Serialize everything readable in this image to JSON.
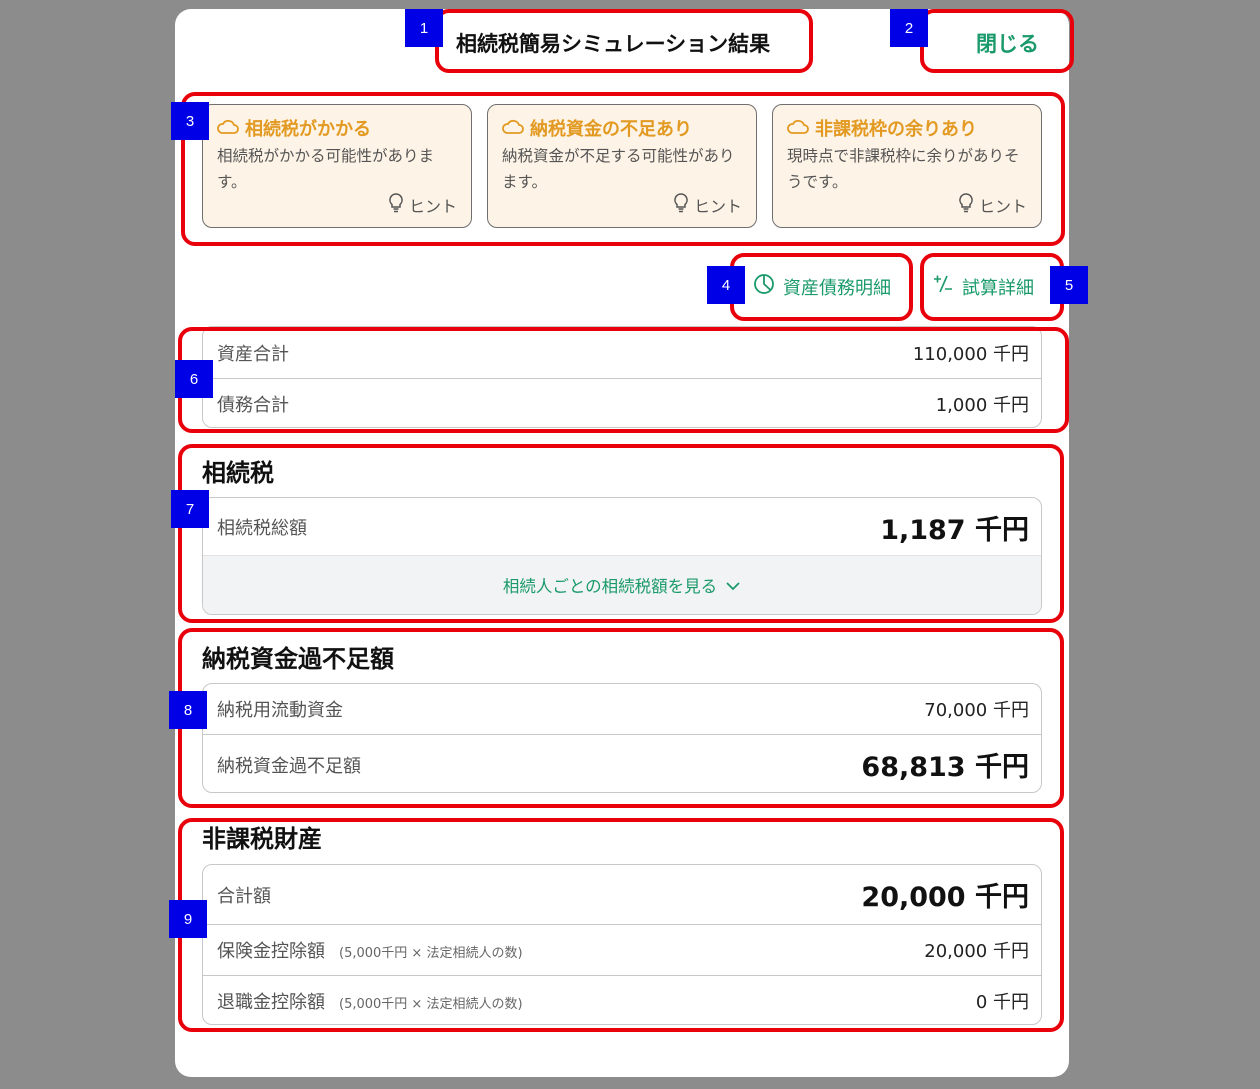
{
  "header": {
    "title": "相続税簡易シミュレーション結果",
    "close_label": "閉じる"
  },
  "markers": [
    "1",
    "2",
    "3",
    "4",
    "5",
    "6",
    "7",
    "8",
    "9"
  ],
  "alerts": [
    {
      "title": "相続税がかかる",
      "body": "相続税がかかる可能性があります。",
      "hint": "ヒント",
      "icon": "cloud-icon"
    },
    {
      "title": "納税資金の不足あり",
      "body": "納税資金が不足する可能性があります。",
      "hint": "ヒント",
      "icon": "cloud-icon"
    },
    {
      "title": "非課税枠の余りあり",
      "body": "現時点で非課税枠に余りがありそうです。",
      "hint": "ヒント",
      "icon": "cloud-icon"
    }
  ],
  "links": {
    "asset_detail": "資産債務明細",
    "calc_detail": "試算詳細"
  },
  "summary": [
    {
      "label": "資産合計",
      "value": "110,000 千円"
    },
    {
      "label": "債務合計",
      "value": "1,000 千円"
    }
  ],
  "inheritance_tax": {
    "title": "相続税",
    "total_label": "相続税総額",
    "total_value": "1,187 千円",
    "expand_label": "相続人ごとの相続税額を見る"
  },
  "funds": {
    "title": "納税資金過不足額",
    "rows": [
      {
        "label": "納税用流動資金",
        "value": "70,000 千円"
      },
      {
        "label": "納税資金過不足額",
        "value": "68,813 千円"
      }
    ]
  },
  "tax_free": {
    "title": "非課税財産",
    "total_label": "合計額",
    "total_value": "20,000 千円",
    "rows": [
      {
        "label": "保険金控除額",
        "note": "(5,000千円 × 法定相続人の数)",
        "value": "20,000 千円"
      },
      {
        "label": "退職金控除額",
        "note": "(5,000千円 × 法定相続人の数)",
        "value": "0 千円"
      }
    ]
  },
  "colors": {
    "accent": "#1a9a6a",
    "warning": "#e39a22",
    "highlight": "#e8000b",
    "marker": "#0000e6"
  }
}
